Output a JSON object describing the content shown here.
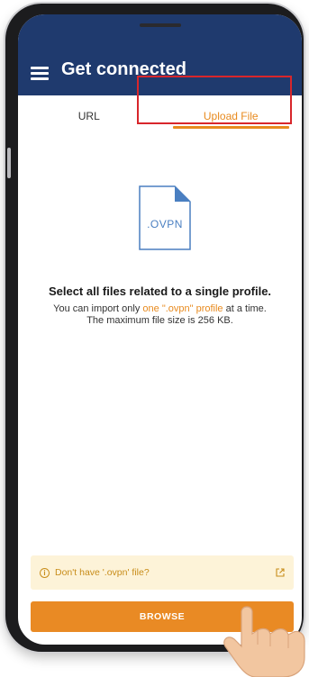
{
  "appbar": {
    "title": "Get connected"
  },
  "tabs": [
    {
      "label": "URL"
    },
    {
      "label": "Upload File"
    }
  ],
  "file_icon": {
    "label": ".OVPN"
  },
  "content": {
    "headline": "Select all files related to a single profile.",
    "desc_before": "You can import only ",
    "desc_accent": "one \".ovpn\" profile",
    "desc_after": " at a time.",
    "desc_line2": "The maximum file size is 256 KB."
  },
  "info_bar": {
    "text": "Don't have '.ovpn' file?"
  },
  "browse_button": {
    "label": "BROWSE"
  },
  "colors": {
    "appbar": "#1f3a6e",
    "accent": "#e88a1e",
    "highlight": "#d8262b",
    "info_bg": "#fdf3d8"
  }
}
